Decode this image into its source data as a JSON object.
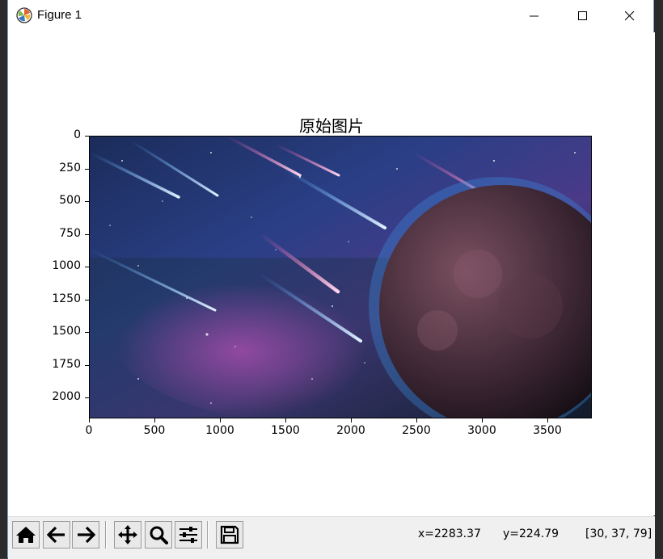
{
  "window": {
    "title": "Figure 1"
  },
  "plot": {
    "title": "原始图片",
    "y_ticks": [
      "0",
      "250",
      "500",
      "750",
      "1000",
      "1250",
      "1500",
      "1750",
      "2000"
    ],
    "x_ticks": [
      "0",
      "500",
      "1000",
      "1500",
      "2000",
      "2500",
      "3000",
      "3500"
    ],
    "image_description_icon": "space-meteor-planet-image"
  },
  "toolbar": {
    "buttons": [
      "home-icon",
      "back-icon",
      "forward-icon",
      "pan-icon",
      "zoom-icon",
      "configure-subplots-icon",
      "save-icon"
    ],
    "x_readout": "x=2283.37",
    "y_readout": "y=224.79",
    "pixel_readout": "[30, 37, 79]"
  },
  "colors": {
    "accent": "#1f6fd0",
    "window_bg": "#ffffff",
    "toolbar_bg": "#f0f0f0"
  }
}
